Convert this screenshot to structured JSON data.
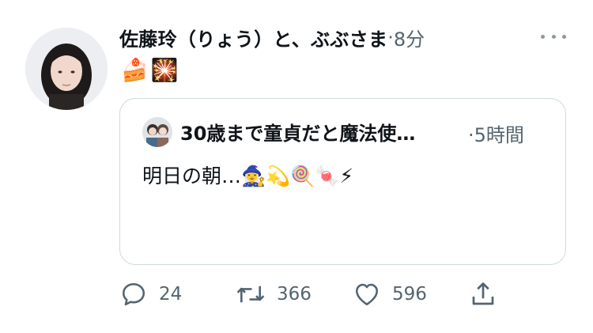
{
  "tweet": {
    "display_name": "佐藤玲（りょう）と、ぶぶさま",
    "time_separator": "·",
    "time_ago": "8分",
    "emojis": [
      "🍰",
      "🎇"
    ]
  },
  "quoted_tweet": {
    "display_name": "30歳まで童貞だと魔法使…",
    "time_separator": "·",
    "time_ago": "5時間",
    "text": "明日の朝…🧙‍♀️💫🍭🍬⚡"
  },
  "actions": {
    "reply_count": "24",
    "retweet_count": "366",
    "like_count": "596"
  },
  "icons": {
    "more": "more-icon",
    "reply": "reply-icon",
    "retweet": "retweet-icon",
    "like": "heart-icon",
    "share": "share-icon"
  },
  "colors": {
    "text_primary": "#0f1419",
    "text_secondary": "#536471",
    "border": "#cfd9de"
  }
}
